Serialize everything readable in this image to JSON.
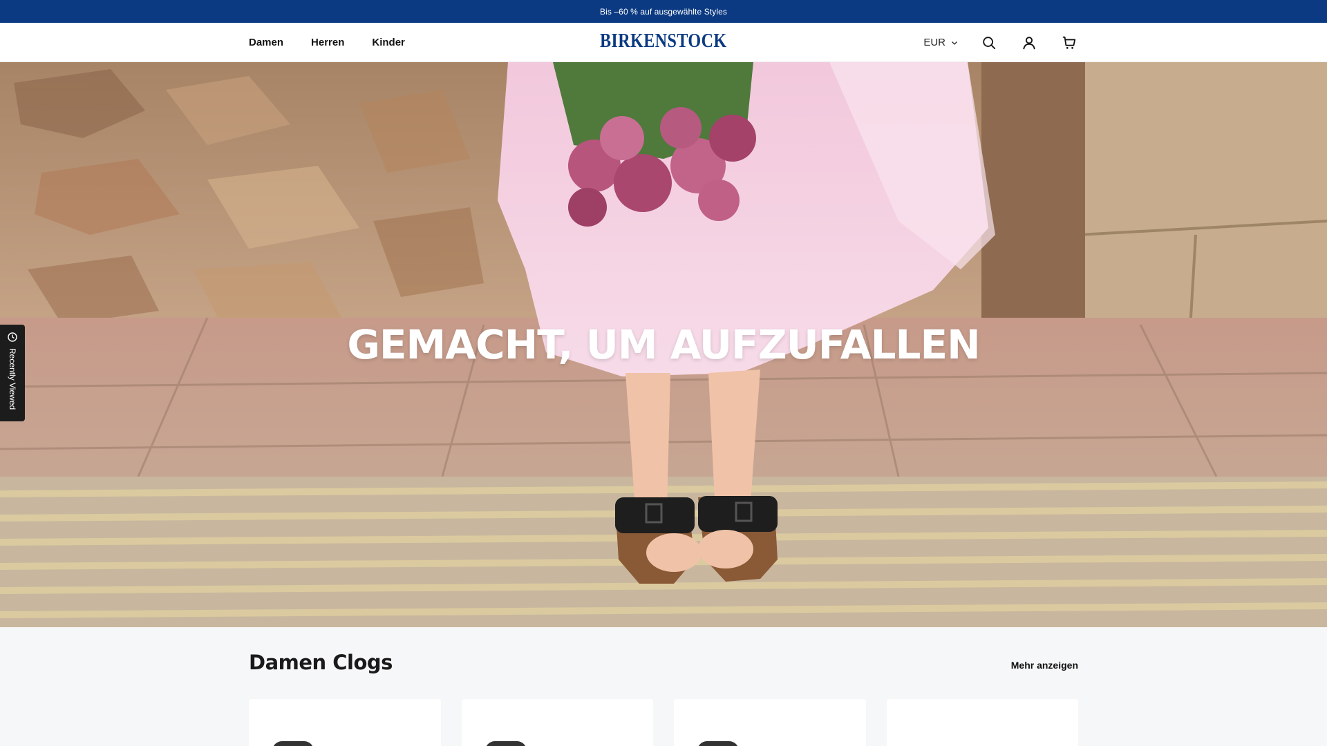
{
  "promo": {
    "text": "Bis –60 % auf ausgewählte Styles"
  },
  "header": {
    "nav": [
      {
        "label": "Damen"
      },
      {
        "label": "Herren"
      },
      {
        "label": "Kinder"
      }
    ],
    "logo": "BIRKENSTOCK",
    "currency": "EUR",
    "icons": [
      "search-icon",
      "account-icon",
      "cart-icon"
    ]
  },
  "hero": {
    "title": "GEMACHT, UM AUFZUFALLEN"
  },
  "recently_viewed": {
    "label": "Recently Viewed"
  },
  "section": {
    "title": "Damen Clogs",
    "more_label": "Mehr anzeigen",
    "product_count_visible": 4
  },
  "colors": {
    "promo_bg": "#0b3a82",
    "brand": "#0b3a82",
    "page_bg": "#f6f7f8"
  }
}
